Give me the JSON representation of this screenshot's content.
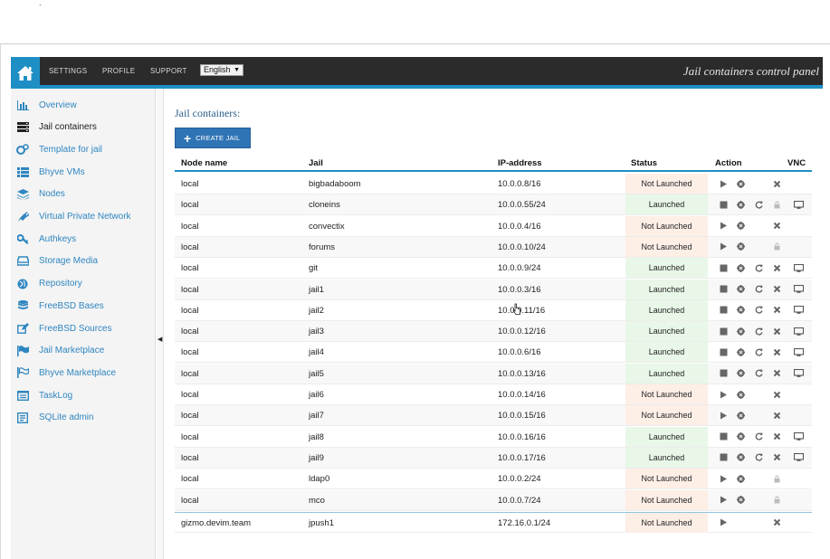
{
  "topbar": {
    "nav": [
      "SETTINGS",
      "PROFILE",
      "SUPPORT"
    ],
    "language": "English",
    "title": "Jail containers control panel"
  },
  "sidebar": {
    "items": [
      {
        "label": "Overview",
        "icon": "bar-chart-icon"
      },
      {
        "label": "Jail containers",
        "icon": "server-icon",
        "active": true
      },
      {
        "label": "Template for jail",
        "icon": "cogs-icon"
      },
      {
        "label": "Bhyve VMs",
        "icon": "list-icon"
      },
      {
        "label": "Nodes",
        "icon": "layers-icon"
      },
      {
        "label": "Virtual Private Network",
        "icon": "plug-icon"
      },
      {
        "label": "Authkeys",
        "icon": "key-icon"
      },
      {
        "label": "Storage Media",
        "icon": "drive-icon"
      },
      {
        "label": "Repository",
        "icon": "globe-icon"
      },
      {
        "label": "FreeBSD Bases",
        "icon": "database-icon"
      },
      {
        "label": "FreeBSD Sources",
        "icon": "edit-icon"
      },
      {
        "label": "Jail Marketplace",
        "icon": "flag-icon"
      },
      {
        "label": "Bhyve Marketplace",
        "icon": "flag-outline-icon"
      },
      {
        "label": "TaskLog",
        "icon": "tasklog-icon"
      },
      {
        "label": "SQLite admin",
        "icon": "sqlite-icon"
      }
    ]
  },
  "main": {
    "title": "Jail containers:",
    "create_button": "CREATE JAIL",
    "columns": [
      "Node name",
      "Jail",
      "IP-address",
      "Status",
      "Action",
      "VNC"
    ],
    "rows": [
      {
        "node": "local",
        "jail": "bigbadaboom",
        "ip": "10.0.0.8/16",
        "status": "Not Launched"
      },
      {
        "node": "local",
        "jail": "cloneins",
        "ip": "10.0.0.55/24",
        "status": "Launched"
      },
      {
        "node": "local",
        "jail": "convectix",
        "ip": "10.0.0.4/16",
        "status": "Not Launched"
      },
      {
        "node": "local",
        "jail": "forums",
        "ip": "10.0.0.10/24",
        "status": "Not Launched"
      },
      {
        "node": "local",
        "jail": "git",
        "ip": "10.0.0.9/24",
        "status": "Launched"
      },
      {
        "node": "local",
        "jail": "jail1",
        "ip": "10.0.0.3/16",
        "status": "Launched"
      },
      {
        "node": "local",
        "jail": "jail2",
        "ip": "10.0.0.11/16",
        "status": "Launched"
      },
      {
        "node": "local",
        "jail": "jail3",
        "ip": "10.0.0.12/16",
        "status": "Launched"
      },
      {
        "node": "local",
        "jail": "jail4",
        "ip": "10.0.0.6/16",
        "status": "Launched"
      },
      {
        "node": "local",
        "jail": "jail5",
        "ip": "10.0.0.13/16",
        "status": "Launched"
      },
      {
        "node": "local",
        "jail": "jail6",
        "ip": "10.0.0.14/16",
        "status": "Not Launched"
      },
      {
        "node": "local",
        "jail": "jail7",
        "ip": "10.0.0.15/16",
        "status": "Not Launched"
      },
      {
        "node": "local",
        "jail": "jail8",
        "ip": "10.0.0.16/16",
        "status": "Launched"
      },
      {
        "node": "local",
        "jail": "jail9",
        "ip": "10.0.0.17/16",
        "status": "Launched"
      },
      {
        "node": "local",
        "jail": "ldap0",
        "ip": "10.0.0.2/24",
        "status": "Not Launched"
      },
      {
        "node": "local",
        "jail": "mco",
        "ip": "10.0.0.7/24",
        "status": "Not Launched"
      },
      {
        "node": "gizmo.devim.team",
        "jail": "jpush1",
        "ip": "172.16.0.1/24",
        "status": "Not Launched"
      }
    ]
  },
  "colors": {
    "topbar": "#2b2b2b",
    "accent": "#1e8fc5",
    "link": "#2f86c0",
    "launched_bg": "#e8f7e7",
    "not_launched_bg": "#fdeee6"
  }
}
